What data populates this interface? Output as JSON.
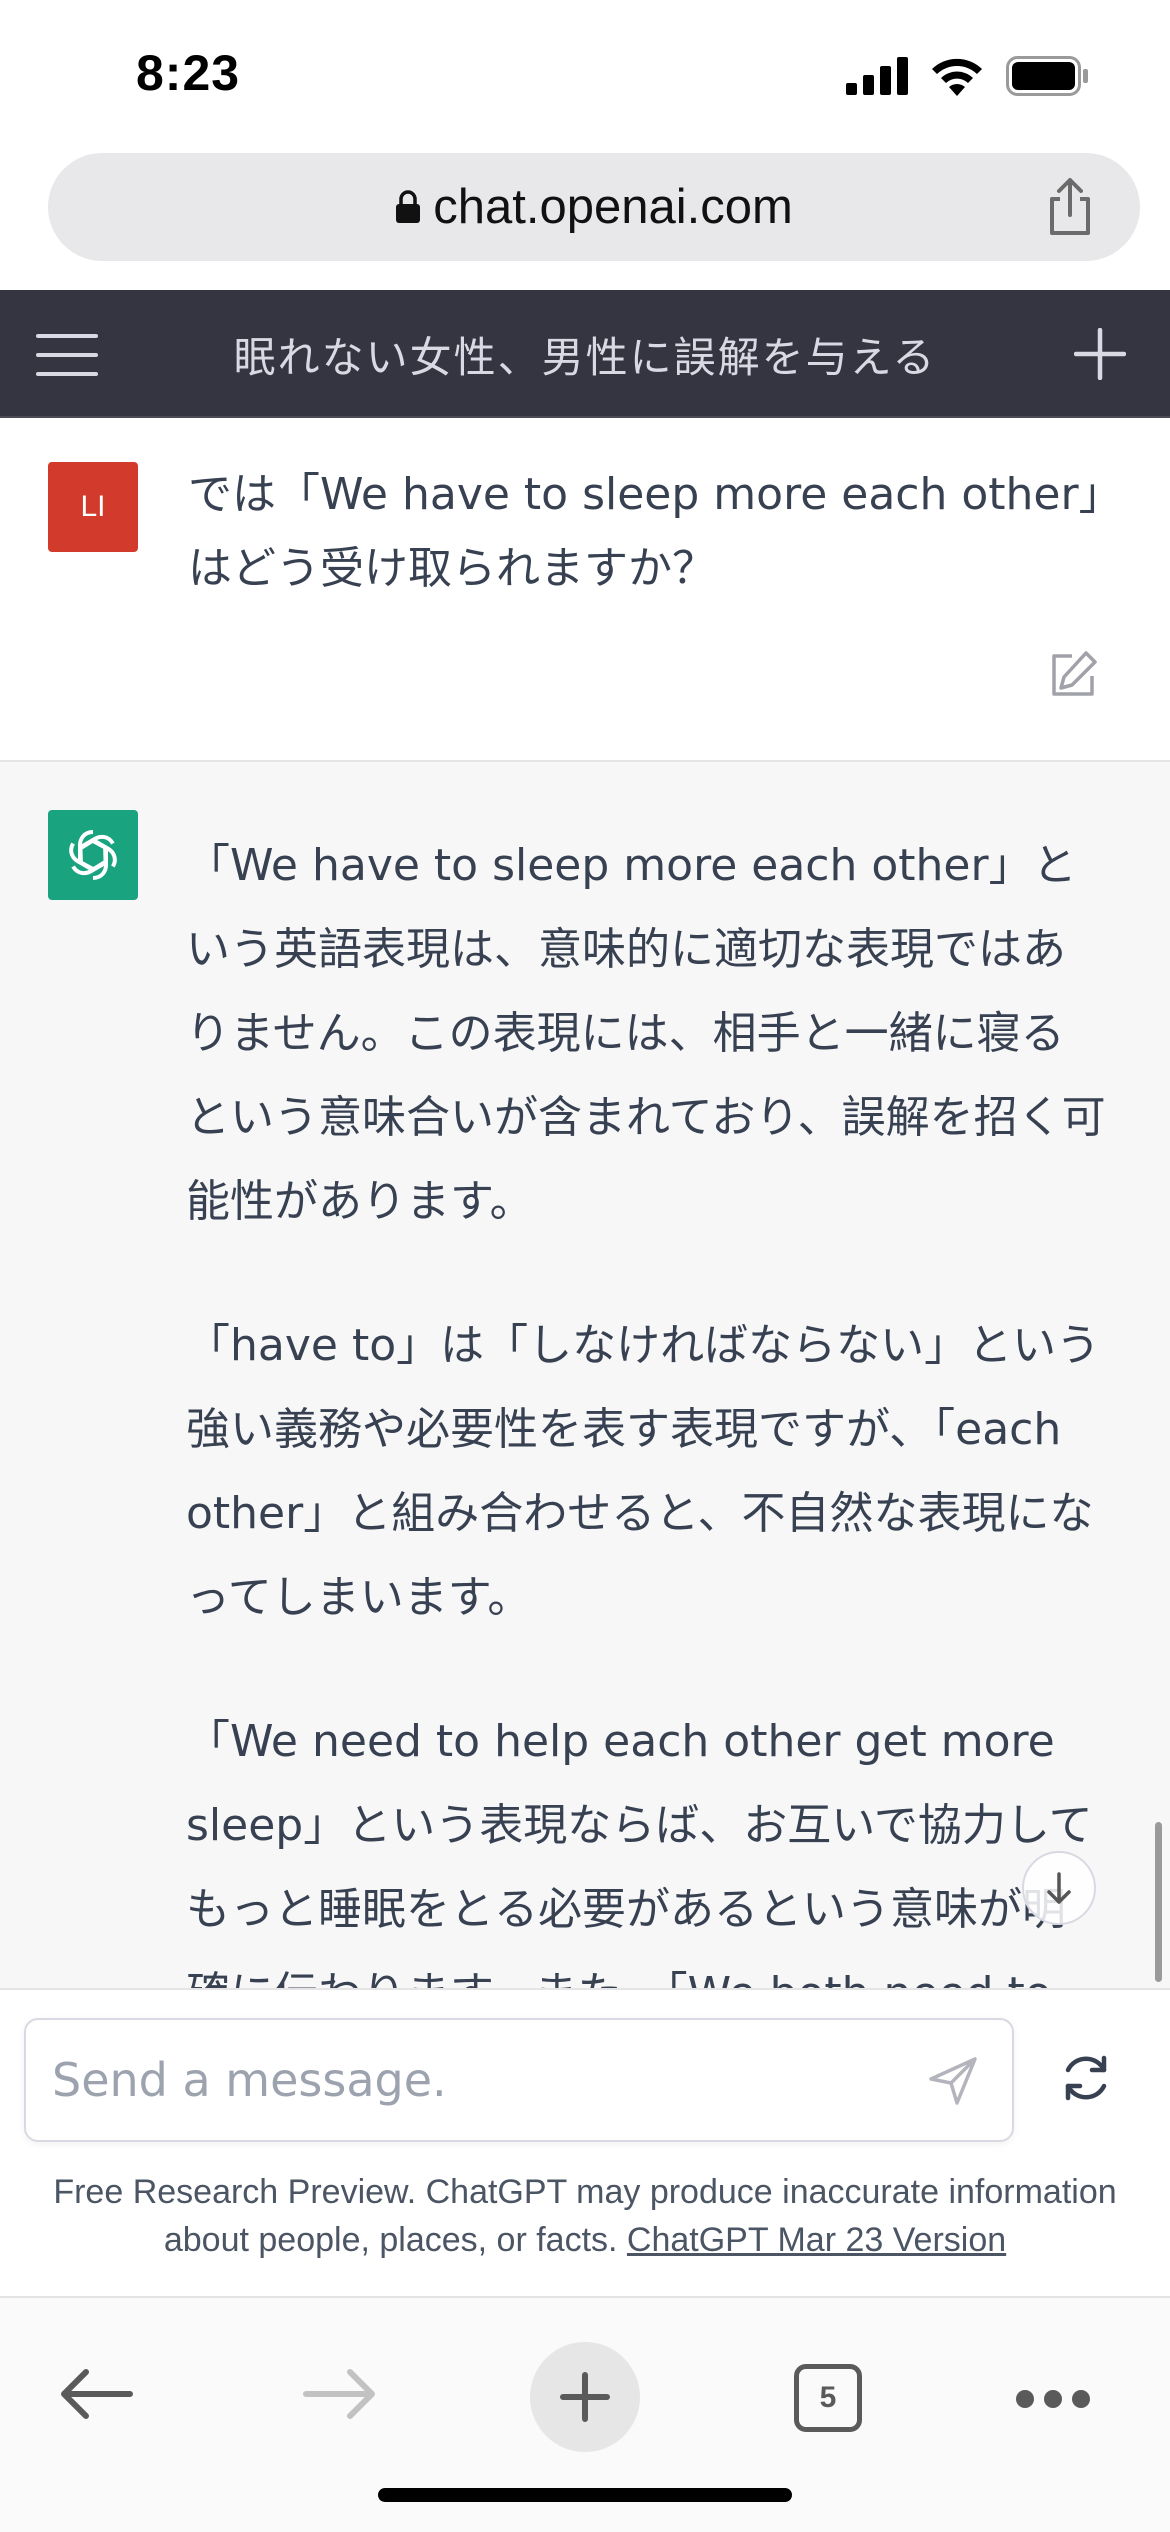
{
  "status_bar": {
    "time": "8:23",
    "icons": [
      "cellular-signal-icon",
      "wifi-icon",
      "battery-icon"
    ]
  },
  "browser": {
    "url": "chat.openai.com",
    "lock_icon": "lock-icon",
    "share_icon": "share-icon"
  },
  "chat_header": {
    "title": "眠れない女性、男性に誤解を与える",
    "menu_icon": "hamburger-menu-icon",
    "new_chat_icon": "plus-icon"
  },
  "conversation": {
    "user_message": {
      "avatar_initials": "LI",
      "text": "では「We have to sleep more each other」はどう受け取られますか？",
      "edit_icon": "edit-icon"
    },
    "assistant_message": {
      "avatar_icon": "openai-logo-icon",
      "paragraphs": [
        "「We have to sleep more each other」という英語表現は、意味的に適切な表現ではありません。この表現には、相手と一緒に寝るという意味合いが含まれており、誤解を招く可能性があります。",
        "「have to」は「しなければならない」という強い義務や必要性を表す表現ですが、「each other」と組み合わせると、不自然な表現になってしまいます。",
        "「We need to help each other get more sleep」という表現ならば、お互いで協力してもっと睡眠をとる必要があるという意味が明確に伝わります。また、「We both need to"
      ]
    },
    "scroll_down_icon": "arrow-down-icon"
  },
  "composer": {
    "placeholder": "Send a message.",
    "value": "",
    "send_icon": "send-icon",
    "regenerate_icon": "refresh-icon",
    "disclaimer_text": "Free Research Preview. ChatGPT may produce inaccurate information about people, places, or facts. ",
    "version_link": "ChatGPT Mar 23 Version"
  },
  "browser_toolbar": {
    "back_icon": "arrow-left-icon",
    "forward_icon": "arrow-right-icon",
    "new_tab_icon": "plus-icon",
    "tab_count": "5",
    "more_icon": "more-horizontal-icon"
  },
  "colors": {
    "header_bg": "#343541",
    "user_avatar": "#d23b2b",
    "assistant_avatar": "#19a37f",
    "assistant_bg": "#f7f7f8"
  }
}
